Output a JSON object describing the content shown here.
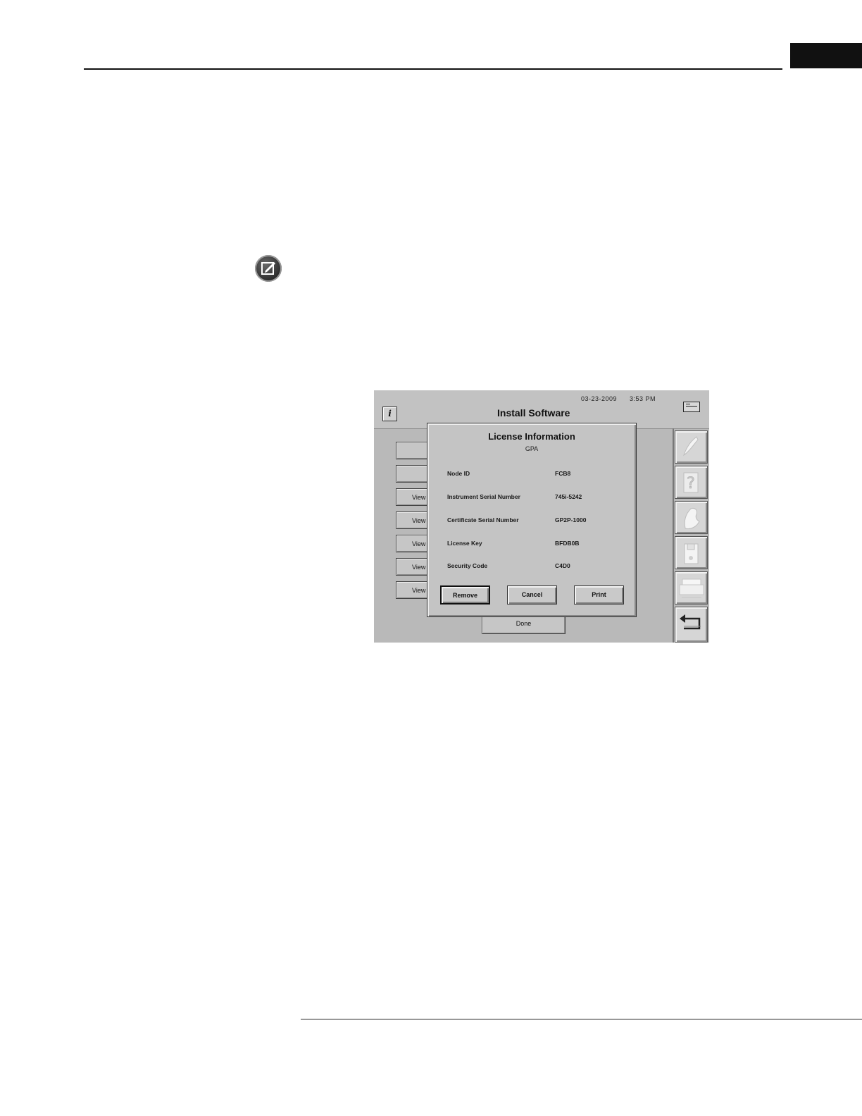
{
  "screen": {
    "header": {
      "date": "03-23-2009",
      "time": "3:53 PM",
      "title": "Install Software",
      "info_glyph": "i"
    },
    "background_buttons": [
      {
        "label": ""
      },
      {
        "label": ""
      },
      {
        "label": "View"
      },
      {
        "label": "View"
      },
      {
        "label": "View"
      },
      {
        "label": "View"
      },
      {
        "label": "View"
      }
    ],
    "done_label": "Done",
    "dialog": {
      "title": "License Information",
      "subtitle": "GPA",
      "fields": [
        {
          "label": "Node ID",
          "value": "FCB8"
        },
        {
          "label": "Instrument Serial Number",
          "value": "745i-5242"
        },
        {
          "label": "Certificate Serial Number",
          "value": "GP2P-1000"
        },
        {
          "label": "License Key",
          "value": "BFDB0B"
        },
        {
          "label": "Security Code",
          "value": "C4D0"
        }
      ],
      "buttons": {
        "remove": "Remove",
        "cancel": "Cancel",
        "print": "Print"
      }
    },
    "sidebar_icons": [
      "brush-icon",
      "help-icon",
      "patient-icon",
      "disk-icon",
      "printer-icon",
      "return-icon"
    ]
  }
}
